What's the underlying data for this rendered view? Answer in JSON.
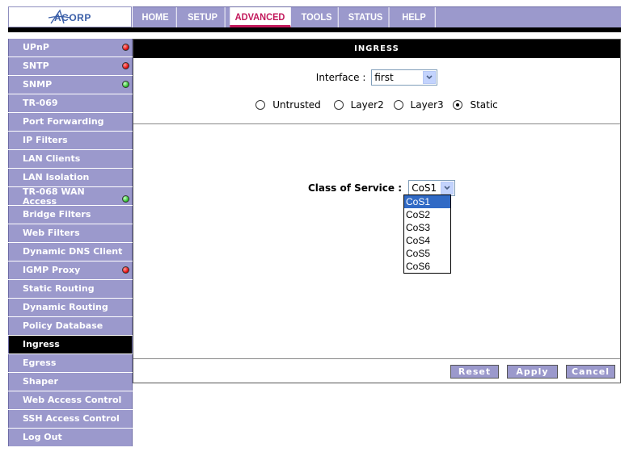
{
  "logo": {
    "text": "ACORP"
  },
  "topnav": [
    "HOME",
    "SETUP",
    "ADVANCED",
    "TOOLS",
    "STATUS",
    "HELP"
  ],
  "sidebar": [
    {
      "label": "UPnP",
      "status": "red"
    },
    {
      "label": "SNTP",
      "status": "red"
    },
    {
      "label": "SNMP",
      "status": "green"
    },
    {
      "label": "TR-069",
      "status": ""
    },
    {
      "label": "Port Forwarding",
      "status": ""
    },
    {
      "label": "IP Filters",
      "status": ""
    },
    {
      "label": "LAN Clients",
      "status": ""
    },
    {
      "label": "LAN Isolation",
      "status": ""
    },
    {
      "label": "TR-068 WAN Access",
      "status": "green"
    },
    {
      "label": "Bridge Filters",
      "status": ""
    },
    {
      "label": "Web Filters",
      "status": ""
    },
    {
      "label": "Dynamic DNS Client",
      "status": ""
    },
    {
      "label": "IGMP Proxy",
      "status": "red"
    },
    {
      "label": "Static Routing",
      "status": ""
    },
    {
      "label": "Dynamic Routing",
      "status": ""
    },
    {
      "label": "Policy Database",
      "status": ""
    },
    {
      "label": "Ingress",
      "status": ""
    },
    {
      "label": "Egress",
      "status": ""
    },
    {
      "label": "Shaper",
      "status": ""
    },
    {
      "label": "Web Access Control",
      "status": ""
    },
    {
      "label": "SSH Access Control",
      "status": ""
    },
    {
      "label": "Log Out",
      "status": ""
    }
  ],
  "panel": {
    "title": "INGRESS",
    "interface_label": "Interface :",
    "interface_value": "first",
    "radios": [
      {
        "label": "Untrusted",
        "checked": false
      },
      {
        "label": "Layer2",
        "checked": false
      },
      {
        "label": "Layer3",
        "checked": false
      },
      {
        "label": "Static",
        "checked": true
      }
    ],
    "cos_label": "Class of Service :",
    "cos_value": "CoS1",
    "cos_options": [
      "CoS1",
      "CoS2",
      "CoS3",
      "CoS4",
      "CoS5",
      "CoS6"
    ],
    "buttons": {
      "reset": "Reset",
      "apply": "Apply",
      "cancel": "Cancel"
    }
  },
  "colors": {
    "nav": "#9b99cc",
    "active_tab": "#c2185b",
    "highlight": "#316ac5"
  }
}
